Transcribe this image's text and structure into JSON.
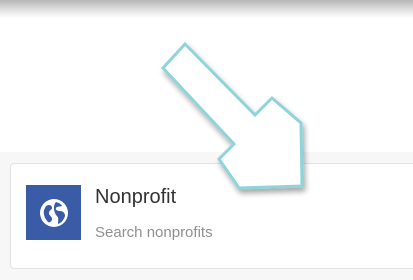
{
  "result_card": {
    "title": "Nonprofit",
    "subtitle": "Search nonprofits",
    "icon": "globe-icon",
    "icon_tile_color": "#3a5ba6"
  },
  "annotation": {
    "icon": "arrow-down-right-icon",
    "outline_color": "#8fd4d8"
  }
}
